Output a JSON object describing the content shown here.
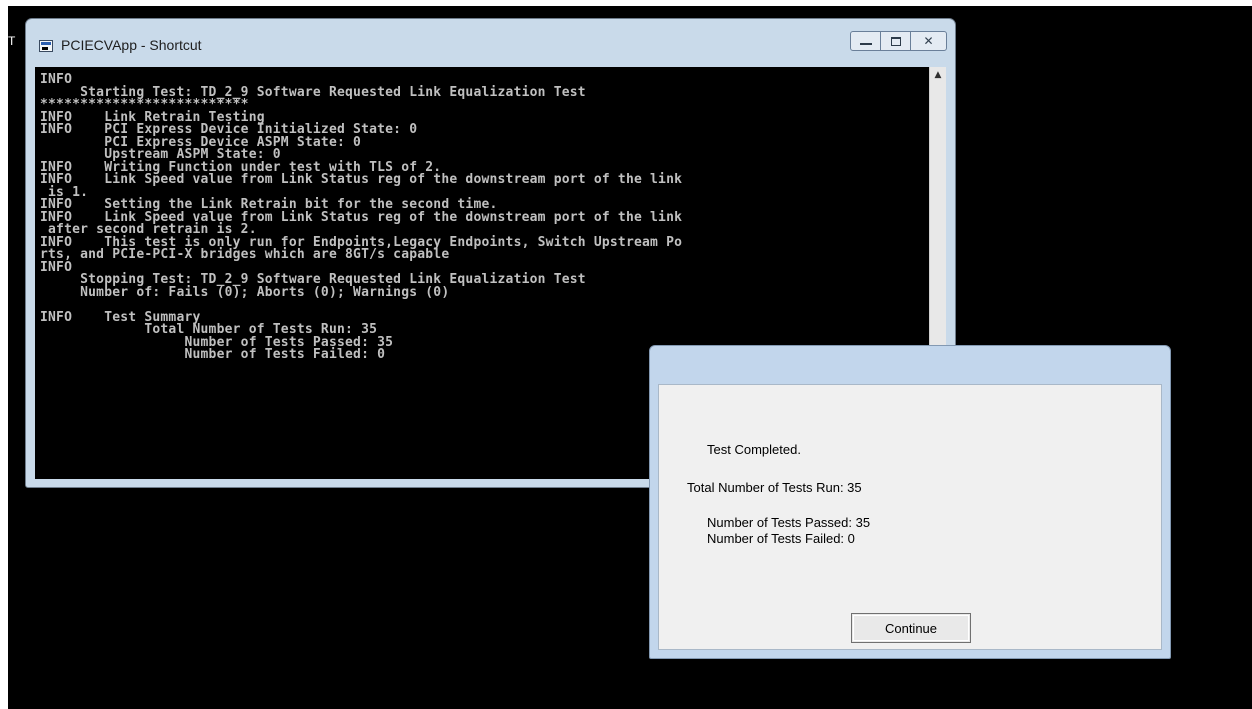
{
  "desktop": {
    "fragment": "T"
  },
  "console": {
    "title": "PCIECVApp - Shortcut",
    "lines": [
      "INFO",
      "     Starting Test: TD_2_9 Software Requested Link Equalization Test",
      "**************************",
      "INFO    Link Retrain Testing",
      "INFO    PCI Express Device Initialized State: 0",
      "        PCI Express Device ASPM State: 0",
      "        Upstream ASPM State: 0",
      "INFO    Writing Function under test with TLS of 2.",
      "INFO    Link Speed value from Link Status reg of the downstream port of the link",
      " is 1.",
      "INFO    Setting the Link Retrain bit for the second time.",
      "INFO    Link Speed value from Link Status reg of the downstream port of the link",
      " after second retrain is 2.",
      "INFO    This test is only run for Endpoints,Legacy Endpoints, Switch Upstream Po",
      "rts, and PCIe-PCI-X bridges which are 8GT/s capable",
      "INFO",
      "     Stopping Test: TD_2_9 Software Requested Link Equalization Test",
      "     Number of: Fails (0); Aborts (0); Warnings (0)",
      "",
      "INFO    Test Summary",
      "             Total Number of Tests Run: 35",
      "                  Number of Tests Passed: 35",
      "                  Number of Tests Failed: 0"
    ]
  },
  "dialog": {
    "completed": "Test Completed.",
    "total": "Total Number of Tests Run: 35",
    "passed": "Number of Tests Passed: 35",
    "failed": "Number of Tests Failed: 0",
    "continue_label": "Continue"
  }
}
